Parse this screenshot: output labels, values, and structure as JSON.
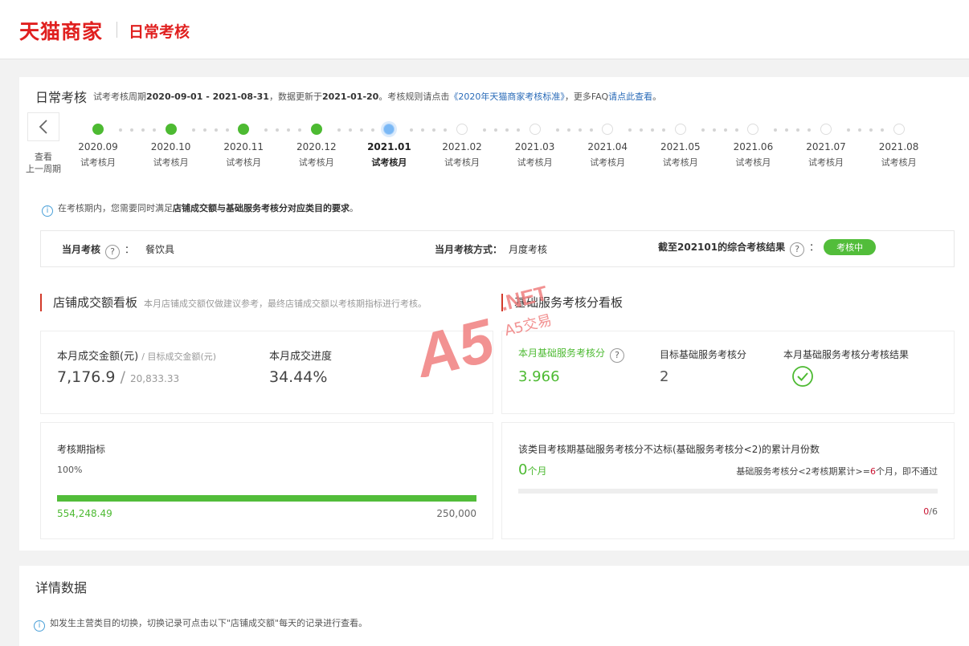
{
  "header": {
    "brand": "天猫商家",
    "page": "日常考核"
  },
  "assessment": {
    "title": "日常考核",
    "desc_prefix": "试考考核周期",
    "period": "2020-09-01 - 2021-08-31",
    "desc_mid1": "，数据更新于",
    "update_date": "2021-01-20",
    "desc_mid2": "。考核规则请点击",
    "rule_link": "《2020年天猫商家考核标准》",
    "desc_mid3": "，更多FAQ",
    "faq_link": "请点此查看",
    "desc_end": "。",
    "prev_label_1": "查看",
    "prev_label_2": "上一周期"
  },
  "timeline": [
    {
      "month": "2020.09",
      "sub": "试考核月",
      "state": "done"
    },
    {
      "month": "2020.10",
      "sub": "试考核月",
      "state": "done"
    },
    {
      "month": "2020.11",
      "sub": "试考核月",
      "state": "done"
    },
    {
      "month": "2020.12",
      "sub": "试考核月",
      "state": "done"
    },
    {
      "month": "2021.01",
      "sub": "试考核月",
      "state": "current"
    },
    {
      "month": "2021.02",
      "sub": "试考核月",
      "state": "future"
    },
    {
      "month": "2021.03",
      "sub": "试考核月",
      "state": "future"
    },
    {
      "month": "2021.04",
      "sub": "试考核月",
      "state": "future"
    },
    {
      "month": "2021.05",
      "sub": "试考核月",
      "state": "future"
    },
    {
      "month": "2021.06",
      "sub": "试考核月",
      "state": "future"
    },
    {
      "month": "2021.07",
      "sub": "试考核月",
      "state": "future"
    },
    {
      "month": "2021.08",
      "sub": "试考核月",
      "state": "future"
    }
  ],
  "notice": {
    "prefix": "在考核期内，您需要同时满足",
    "bold": "店铺成交额与基础服务考核分对应类目的要求",
    "suffix": "。"
  },
  "current_month": {
    "label": "当月考核",
    "category": "餐饮具",
    "method_label": "当月考核方式：",
    "method_value": "月度考核",
    "result_label": "截至202101的综合考核结果",
    "result_value": "考核中"
  },
  "gmv_board": {
    "title": "店铺成交额看板",
    "subtitle": "本月店铺成交额仅做建议参考，最终店铺成交额以考核期指标进行考核。",
    "amount_label": "本月成交金额(元)",
    "target_label": "/ 目标成交金额(元)",
    "amount": "7,176.9",
    "target": "20,833.33",
    "progress_label": "本月成交进度",
    "progress_value": "34.44%",
    "period_label": "考核期指标",
    "period_pct": "100%",
    "period_progress": 1.0,
    "period_actual": "554,248.49",
    "period_target": "250,000"
  },
  "service_board": {
    "title": "基础服务考核分看板",
    "score_label": "本月基础服务考核分",
    "score_value": "3.966",
    "target_label": "目标基础服务考核分",
    "target_value": "2",
    "result_label": "本月基础服务考核分考核结果",
    "fail_title": "该类目考核期基础服务考核分不达标(基础服务考核分<2)的累计月份数",
    "fail_count": "0",
    "fail_unit": "个月",
    "rule_prefix": "基础服务考核分<2考核期累计>=",
    "rule_num": "6",
    "rule_suffix": "个月，即不通过",
    "ratio_num": "0",
    "ratio_den": "/6",
    "fail_progress": 0.0
  },
  "detail": {
    "title": "详情数据",
    "info": "如发生主营类目的切换，切换记录可点击以下\"店铺成交额\"每天的记录进行查看。"
  },
  "watermark": {
    "text1": "A5",
    "text2": ".NET",
    "text3": "A5交易"
  },
  "colors": {
    "brand_red": "#e0201f",
    "green": "#4dba32",
    "link_blue": "#2a6bb8",
    "current_blue": "#7ab8f5",
    "watermark": "#f08080"
  }
}
